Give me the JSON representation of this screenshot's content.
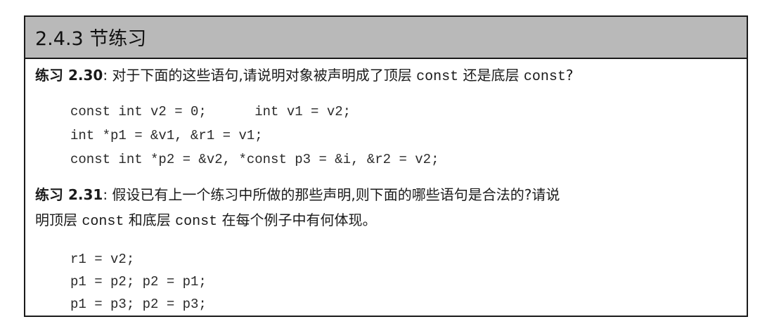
{
  "section": {
    "title": "2.4.3 节练习"
  },
  "exercise_230": {
    "label": "练习 2.30",
    "sep": ": ",
    "text_a": "对于下面的这些语句,请说明对象被声明成了顶层 ",
    "kw1": "const",
    "text_b": " 还是底层 ",
    "kw2": "const",
    "text_c": "?",
    "code": [
      "const int v2 = 0;      int v1 = v2;",
      "int *p1 = &v1, &r1 = v1;",
      "const int *p2 = &v2, *const p3 = &i, &r2 = v2;"
    ]
  },
  "exercise_231": {
    "label": "练习 2.31",
    "sep": ": ",
    "line1": "假设已有上一个练习中所做的那些声明,则下面的哪些语句是合法的?请说",
    "line2_a": "明顶层 ",
    "kw1": "const",
    "line2_b": " 和底层 ",
    "kw2": "const",
    "line2_c": " 在每个例子中有何体现。",
    "code": [
      "r1 = v2;",
      "p1 = p2; p2 = p1;",
      "p1 = p3; p2 = p3;"
    ]
  }
}
